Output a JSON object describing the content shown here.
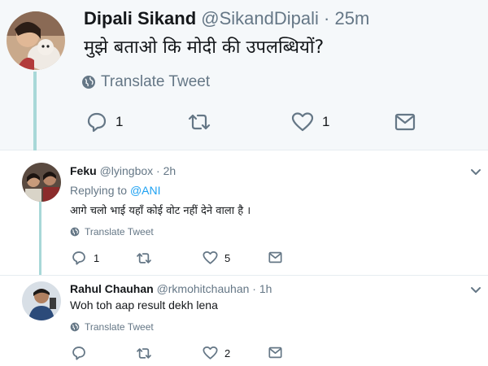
{
  "main_tweet": {
    "name": "Dipali Sikand",
    "handle": "@SikandDipali",
    "separator": "·",
    "time": "25m",
    "text": "मुझे बताओ कि मोदी की उपलब्धियों?",
    "translate_label": "Translate Tweet",
    "reply_count": "1",
    "retweet_count": "",
    "like_count": "1"
  },
  "replies": [
    {
      "name": "Feku",
      "handle": "@lyingbox",
      "separator": "·",
      "time": "2h",
      "replying_prefix": "Replying to",
      "replying_to": "@ANI",
      "text": "आगे चलो भाई यहाँ कोई वोट नहीं देने वाला है ।",
      "translate_label": "Translate Tweet",
      "reply_count": "1",
      "retweet_count": "",
      "like_count": "5"
    },
    {
      "name": "Rahul Chauhan",
      "handle": "@rkmohitchauhan",
      "separator": "·",
      "time": "1h",
      "text": "Woh toh aap result dekh lena",
      "translate_label": "Translate Tweet",
      "reply_count": "",
      "retweet_count": "",
      "like_count": "2"
    }
  ],
  "colors": {
    "background": "#ffffff",
    "highlight_bg": "#f5f8fa",
    "thread_line": "#a8d8d8",
    "text": "#14171a",
    "secondary": "#657786",
    "link": "#1da1f2"
  },
  "icons": [
    "globe-icon",
    "reply-icon",
    "retweet-icon",
    "like-icon",
    "message-icon",
    "chevron-down-icon"
  ]
}
